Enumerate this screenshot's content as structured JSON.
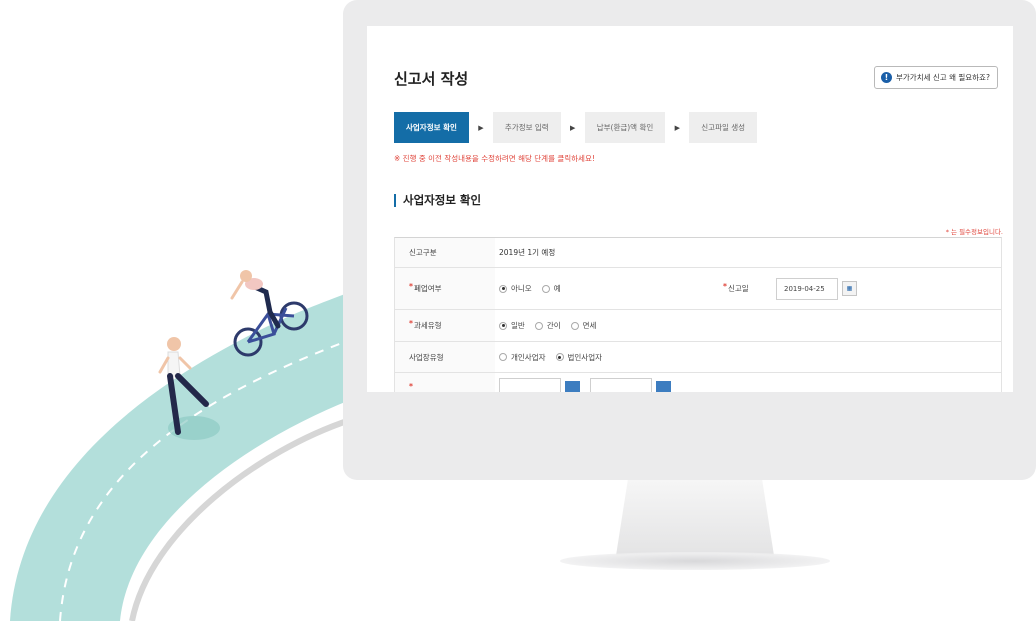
{
  "page": {
    "title": "신고서 작성",
    "help_label": "부가가치세 신고 왜 필요하죠?",
    "help_icon": "info-icon",
    "notice": "※ 진행 중 이전 작성내용을 수정하려면 해당 단계를 클릭하세요!",
    "section_title": "사업자정보 확인",
    "required_note": "* 는 필수정보입니다."
  },
  "steps": [
    {
      "label": "사업자정보 확인",
      "active": true
    },
    {
      "label": "추가정보 입력",
      "active": false
    },
    {
      "label": "납부(환급)액 확인",
      "active": false
    },
    {
      "label": "신고파일 생성",
      "active": false
    }
  ],
  "form": {
    "report_type_label": "신고구분",
    "report_type_value": "2019년 1기 예정",
    "closure_label": "폐업여부",
    "closure_options": [
      "아니오",
      "예"
    ],
    "closure_selected": "아니오",
    "report_date_label": "신고일",
    "report_date_value": "2019-04-25",
    "tax_type_label": "과세유형",
    "tax_type_options": [
      "일반",
      "간이",
      "면세"
    ],
    "tax_type_selected": "일반",
    "biz_type_label": "사업장유형",
    "biz_type_options": [
      "개인사업자",
      "법인사업자"
    ],
    "biz_type_selected": "법인사업자"
  },
  "colors": {
    "accent": "#146da7",
    "required": "#e0463c",
    "road": "#b3dfdb",
    "monitor": "#ebebec"
  }
}
